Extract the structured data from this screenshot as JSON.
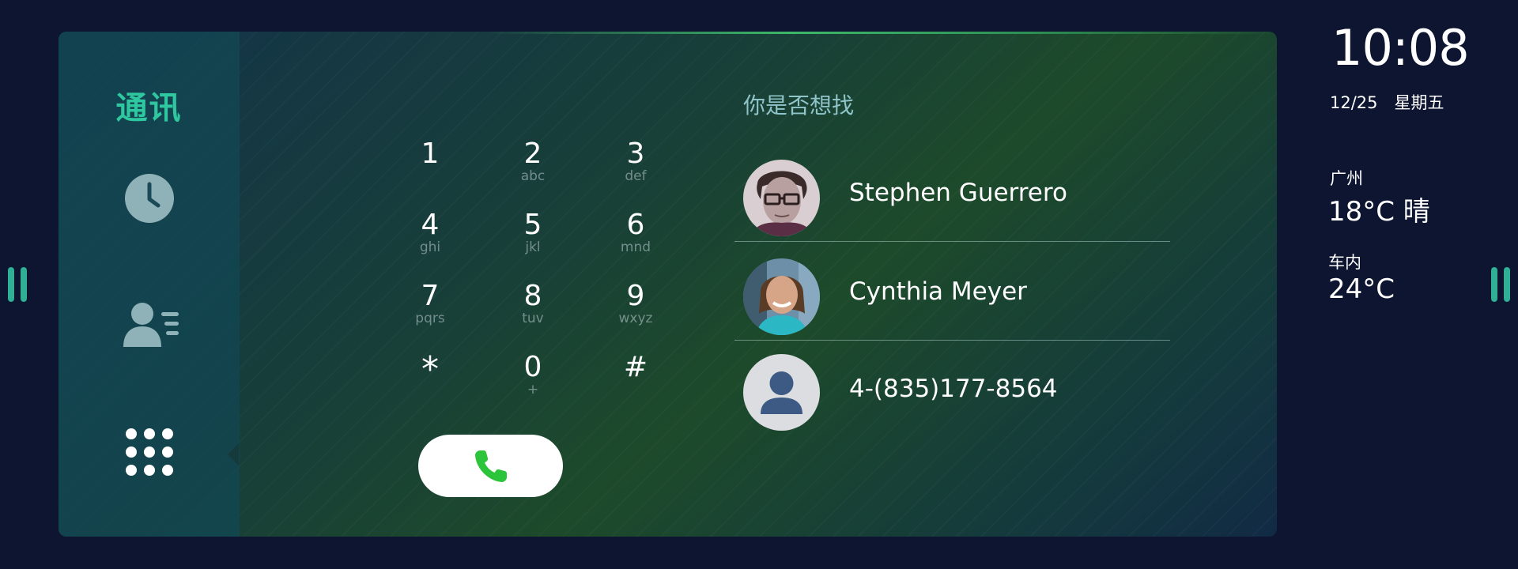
{
  "sidebar": {
    "title": "通讯",
    "items": [
      {
        "name": "history",
        "icon": "clock-icon"
      },
      {
        "name": "contacts",
        "icon": "contacts-icon"
      },
      {
        "name": "dialpad",
        "icon": "dialpad-icon",
        "active": true
      }
    ]
  },
  "keypad": {
    "keys": [
      {
        "digit": "1",
        "letters": ""
      },
      {
        "digit": "2",
        "letters": "abc"
      },
      {
        "digit": "3",
        "letters": "def"
      },
      {
        "digit": "4",
        "letters": "ghi"
      },
      {
        "digit": "5",
        "letters": "jkl"
      },
      {
        "digit": "6",
        "letters": "mnd"
      },
      {
        "digit": "7",
        "letters": "pqrs"
      },
      {
        "digit": "8",
        "letters": "tuv"
      },
      {
        "digit": "9",
        "letters": "wxyz"
      },
      {
        "digit": "*",
        "letters": ""
      },
      {
        "digit": "0",
        "letters": "+"
      },
      {
        "digit": "#",
        "letters": ""
      }
    ],
    "call_icon": "phone-icon",
    "call_color": "#2bc43a"
  },
  "suggestions": {
    "title": "你是否想找",
    "contacts": [
      {
        "name": "Stephen Guerrero",
        "avatar": "photo-avatar-stephen"
      },
      {
        "name": "Cynthia Meyer",
        "avatar": "photo-avatar-cynthia"
      },
      {
        "name": "4-(835)177-8564",
        "avatar": "default-person-icon"
      }
    ]
  },
  "status": {
    "time": "10:08",
    "date": "12/25　星期五",
    "city": "广州",
    "weather": "18°C 晴",
    "cabin_label": "车内",
    "cabin_temp": "24°C"
  },
  "colors": {
    "accent": "#2ec7a0",
    "background": "#0d1530",
    "grip": "#2fb095"
  }
}
